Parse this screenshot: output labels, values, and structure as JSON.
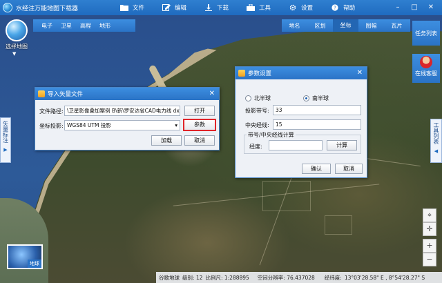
{
  "app": {
    "title": "水经注万能地图下载器",
    "menu": [
      "文件",
      "编辑",
      "下载",
      "工具",
      "设置",
      "帮助"
    ]
  },
  "map_select": {
    "label": "选择地图"
  },
  "map_tabs_left": [
    "电子",
    "卫星",
    "高程",
    "地形"
  ],
  "map_tabs_right": [
    "地名",
    "区划",
    "坐标",
    "图幅",
    "瓦片"
  ],
  "map_tabs_right_active": "坐标",
  "task_list": "任务列表",
  "online_service": "在线客服",
  "left_vtab": "矢量标注",
  "right_vtab": "工具列表",
  "thumbnail_label": "地球",
  "statusbar": {
    "source": "谷歌地球",
    "level": "级别: 12",
    "scale": "比例尺: 1:288895",
    "resolution": "空间分辨率: 76.437028",
    "lon_label": "经纬度:",
    "coords": "13°03'28.58\" E , 8°54'28.27\" S"
  },
  "import_dialog": {
    "title": "导入矢量文件",
    "path_label": "文件路径:",
    "path_value": "\\卫星影像叠加案例 B\\新\\罗安达省CAD电力线 dxf.",
    "open_button": "打开",
    "proj_label": "坐标投影:",
    "proj_value": "WGS84 UTM 投影",
    "param_button": "参数",
    "load_button": "加载",
    "cancel_button": "取消"
  },
  "param_dialog": {
    "title": "参数设置",
    "north_label": "北半球",
    "south_label": "南半球",
    "zone_label": "投影带号:",
    "zone_value": "33",
    "meridian_label": "中央经线:",
    "meridian_value": "15",
    "group_label": "带号/中央经线计算",
    "lon_label": "经度:",
    "lon_value": "",
    "calc_button": "计算",
    "ok_button": "确认",
    "cancel_button": "取消"
  }
}
